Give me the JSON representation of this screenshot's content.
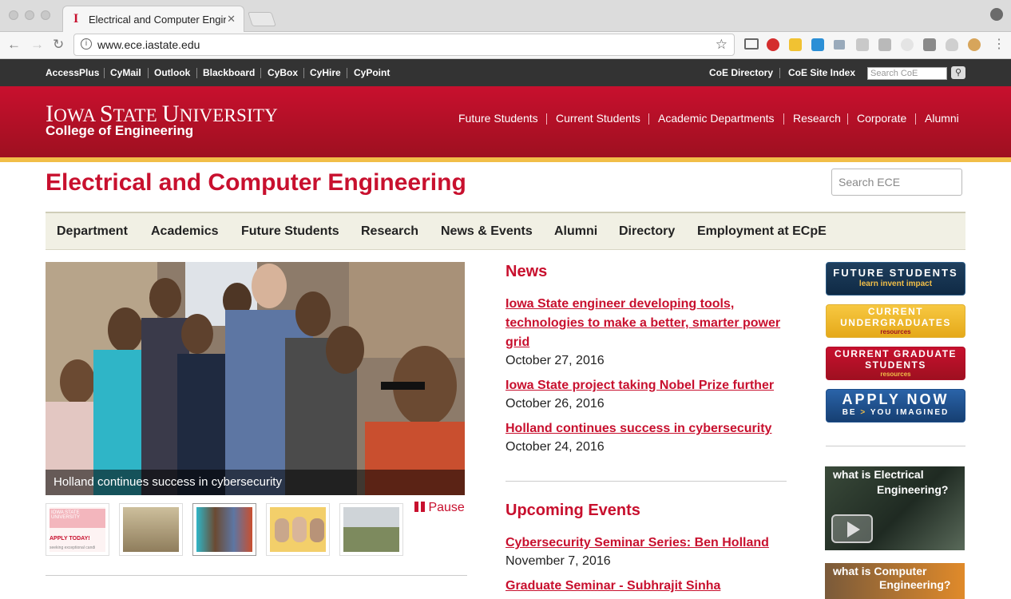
{
  "browser": {
    "tab_title": "Electrical and Computer Engineering",
    "url": "www.ece.iastate.edu"
  },
  "utility_nav": {
    "left": [
      "AccessPlus",
      "CyMail",
      "Outlook",
      "Blackboard",
      "CyBox",
      "CyHire",
      "CyPoint"
    ],
    "right": [
      "CoE Directory",
      "CoE Site Index"
    ],
    "search_placeholder": "Search CoE"
  },
  "header": {
    "wordmark_big_i": "I",
    "wordmark_small_1": "OWA ",
    "wordmark_big_s": "S",
    "wordmark_small_2": "TATE ",
    "wordmark_big_u": "U",
    "wordmark_small_3": "NIVERSITY",
    "college": "College of Engineering",
    "nav": [
      "Future Students",
      "Current Students",
      "Academic Departments",
      "Research",
      "Corporate",
      "Alumni"
    ]
  },
  "page": {
    "title": "Electrical and Computer Engineering",
    "search_placeholder": "Search ECE"
  },
  "subnav": [
    "Department",
    "Academics",
    "Future Students",
    "Research",
    "News & Events",
    "Alumni",
    "Directory",
    "Employment at ECpE"
  ],
  "slideshow": {
    "caption": "Holland continues success in cybersecurity",
    "pause_label": "Pause",
    "thumb1_line1": "IOWA STATE UNIVERSITY",
    "thumb1_line2": "APPLY TODAY!",
    "thumb1_line3": "seeking exceptional candi"
  },
  "news": {
    "heading": "News",
    "items": [
      {
        "title": "Iowa State engineer developing tools, technologies to make a better, smarter power grid",
        "date": "October 27, 2016"
      },
      {
        "title": "Iowa State project taking Nobel Prize further",
        "date": "October 26, 2016"
      },
      {
        "title": "Holland continues success in cybersecurity",
        "date": "October 24, 2016"
      }
    ]
  },
  "events": {
    "heading": "Upcoming Events",
    "items": [
      {
        "title": "Cybersecurity Seminar Series: Ben Holland",
        "date": "November 7, 2016"
      },
      {
        "title": "Graduate Seminar - Subhrajit Sinha",
        "date": ""
      }
    ]
  },
  "promos": {
    "future": {
      "title": "FUTURE STUDENTS",
      "sub": "learn invent impact"
    },
    "undergrad": {
      "title1": "CURRENT",
      "title2": "UNDERGRADUATES",
      "sub": "resources"
    },
    "grad": {
      "title1": "CURRENT GRADUATE",
      "title2": "STUDENTS",
      "sub": "resources"
    },
    "apply": {
      "title": "APPLY NOW",
      "sub_a": "BE",
      "sub_arrow": ">",
      "sub_b": "YOU IMAGINED"
    }
  },
  "videos": [
    {
      "line1": "what is Electrical",
      "line2": "Engineering?"
    },
    {
      "line1": "what is Computer",
      "line2": "Engineering?"
    }
  ],
  "colors": {
    "isu_red": "#c8102e",
    "isu_gold": "#f1be48",
    "apply_blue": "#1e4f8c"
  }
}
